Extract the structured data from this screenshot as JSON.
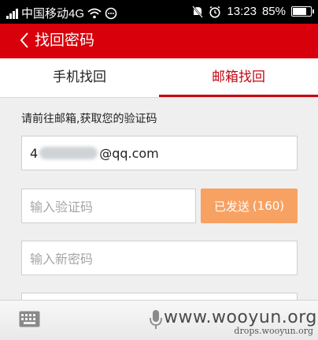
{
  "status_bar": {
    "carrier": "中国移动4G",
    "time": "13:23",
    "battery_percent": "85%",
    "battery_level": 0.85
  },
  "header": {
    "title": "找回密码"
  },
  "tabs": [
    {
      "label": "手机找回",
      "active": false
    },
    {
      "label": "邮箱找回",
      "active": true
    }
  ],
  "form": {
    "hint": "请前往邮箱,获取您的验证码",
    "email_prefix": "4",
    "email_suffix": "@qq.com",
    "code_placeholder": "输入验证码",
    "send_button_label": "已发送",
    "send_countdown": "(160)",
    "new_password_placeholder": "输入新密码"
  },
  "keyboard_bar": {
    "watermark": "www.wooyun.org",
    "watermark_small": "drops.wooyun.org"
  },
  "colors": {
    "header_red": "#d8000a",
    "active_tab_red": "#c40812",
    "send_button_orange": "#f7a162"
  }
}
